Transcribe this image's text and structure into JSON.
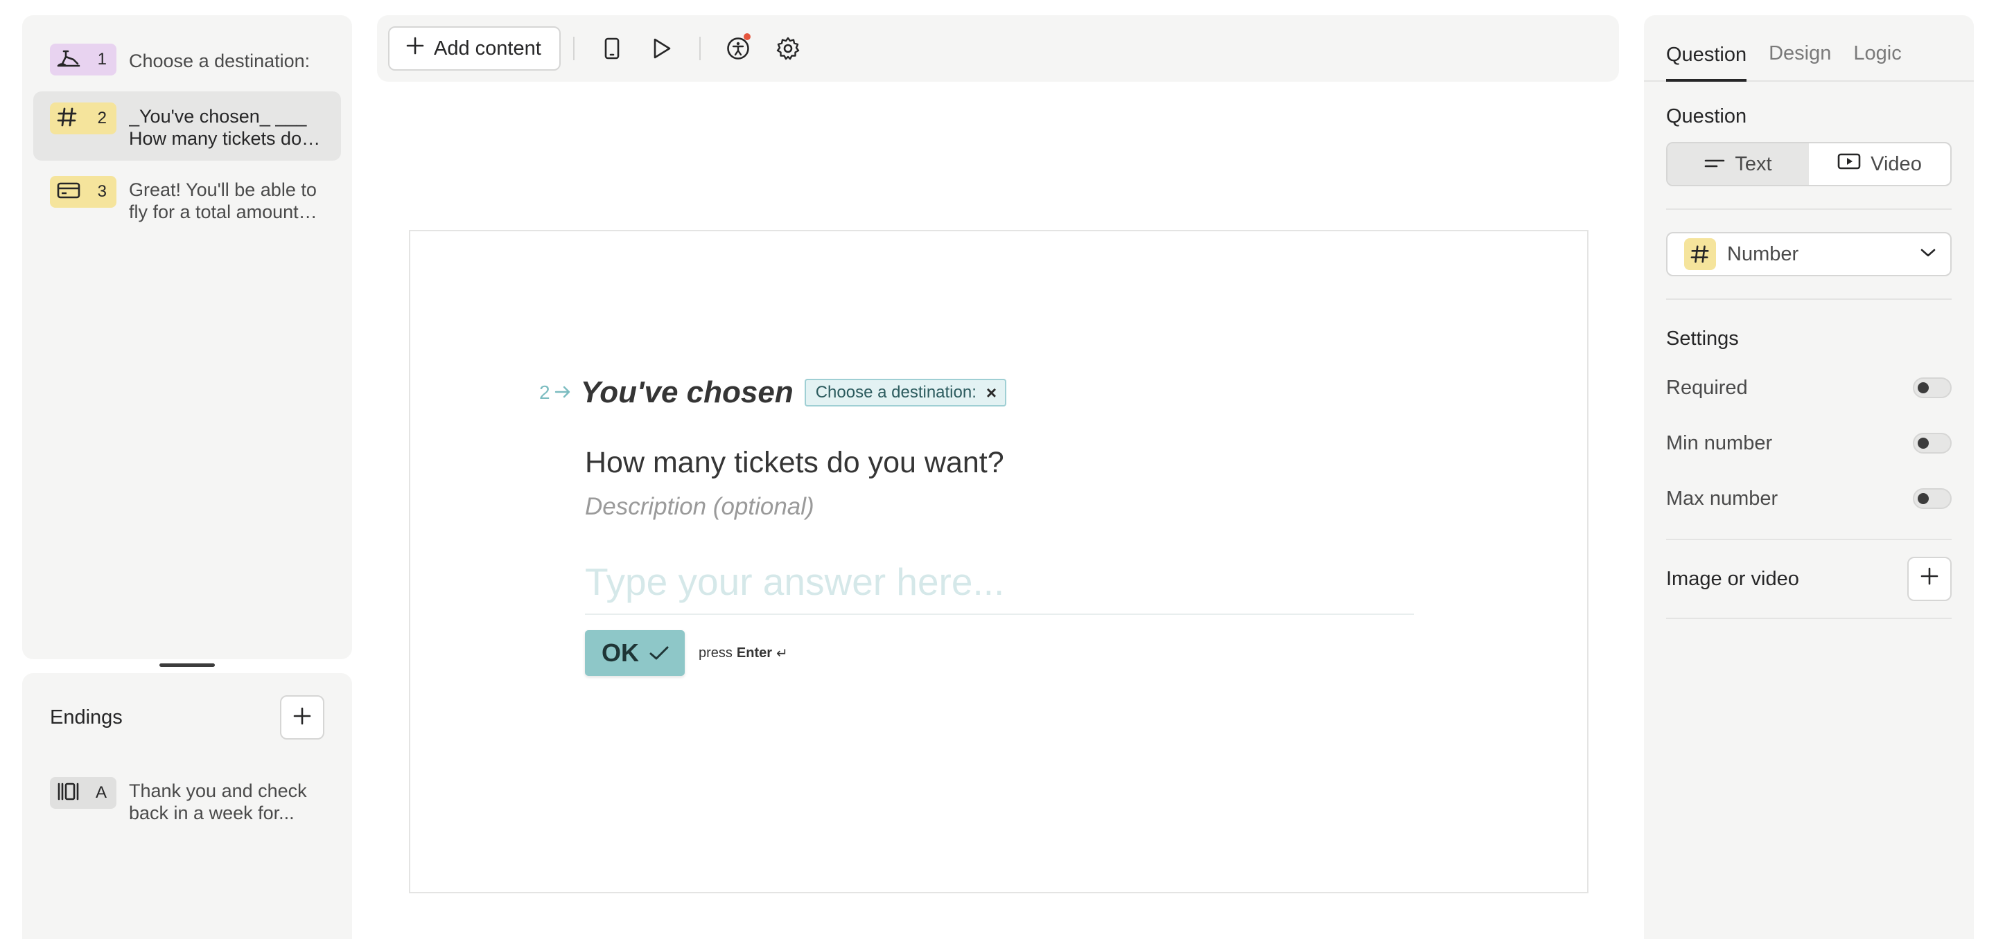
{
  "questions": [
    {
      "number": "1",
      "text": "Choose a destination:",
      "icon": "opinion-scale-icon",
      "badge_color": "#e8d3f0"
    },
    {
      "number": "2",
      "text": "_You've chosen_ ___\nHow many tickets do you want?",
      "icon": "number-hash-icon",
      "badge_color": "#f5e49c"
    },
    {
      "number": "3",
      "text": "Great! You'll be able to fly for a total amount of...",
      "icon": "payment-card-icon",
      "badge_color": "#f5e49c"
    }
  ],
  "endings": {
    "title": "Endings",
    "items": [
      {
        "letter": "A",
        "text": "Thank you and check back in a week for...",
        "icon": "ending-screen-icon"
      }
    ]
  },
  "toolbar": {
    "add_content_label": "Add content",
    "icons": [
      "mobile-preview-icon",
      "play-preview-icon",
      "accessibility-icon",
      "settings-gear-icon"
    ],
    "notification_color": "#e5553d"
  },
  "preview": {
    "question_index": "2",
    "title": "You've chosen",
    "recall_chip": "Choose a destination:",
    "recall_chip_remove": "×",
    "question": "How many tickets do you want?",
    "description_placeholder": "Description (optional)",
    "answer_placeholder": "Type your answer here...",
    "ok_label": "OK",
    "press_label": "press",
    "enter_label": "Enter",
    "enter_symbol": "↵",
    "accent_color": "#8ec7c8"
  },
  "panel": {
    "tabs": [
      "Question",
      "Design",
      "Logic"
    ],
    "active_tab": "Question",
    "question_section_title": "Question",
    "format_options": [
      "Text",
      "Video"
    ],
    "active_format": "Text",
    "question_type": "Number",
    "settings_title": "Settings",
    "settings": [
      {
        "label": "Required",
        "enabled": false
      },
      {
        "label": "Min number",
        "enabled": false
      },
      {
        "label": "Max number",
        "enabled": false
      }
    ],
    "media_label": "Image or video"
  }
}
